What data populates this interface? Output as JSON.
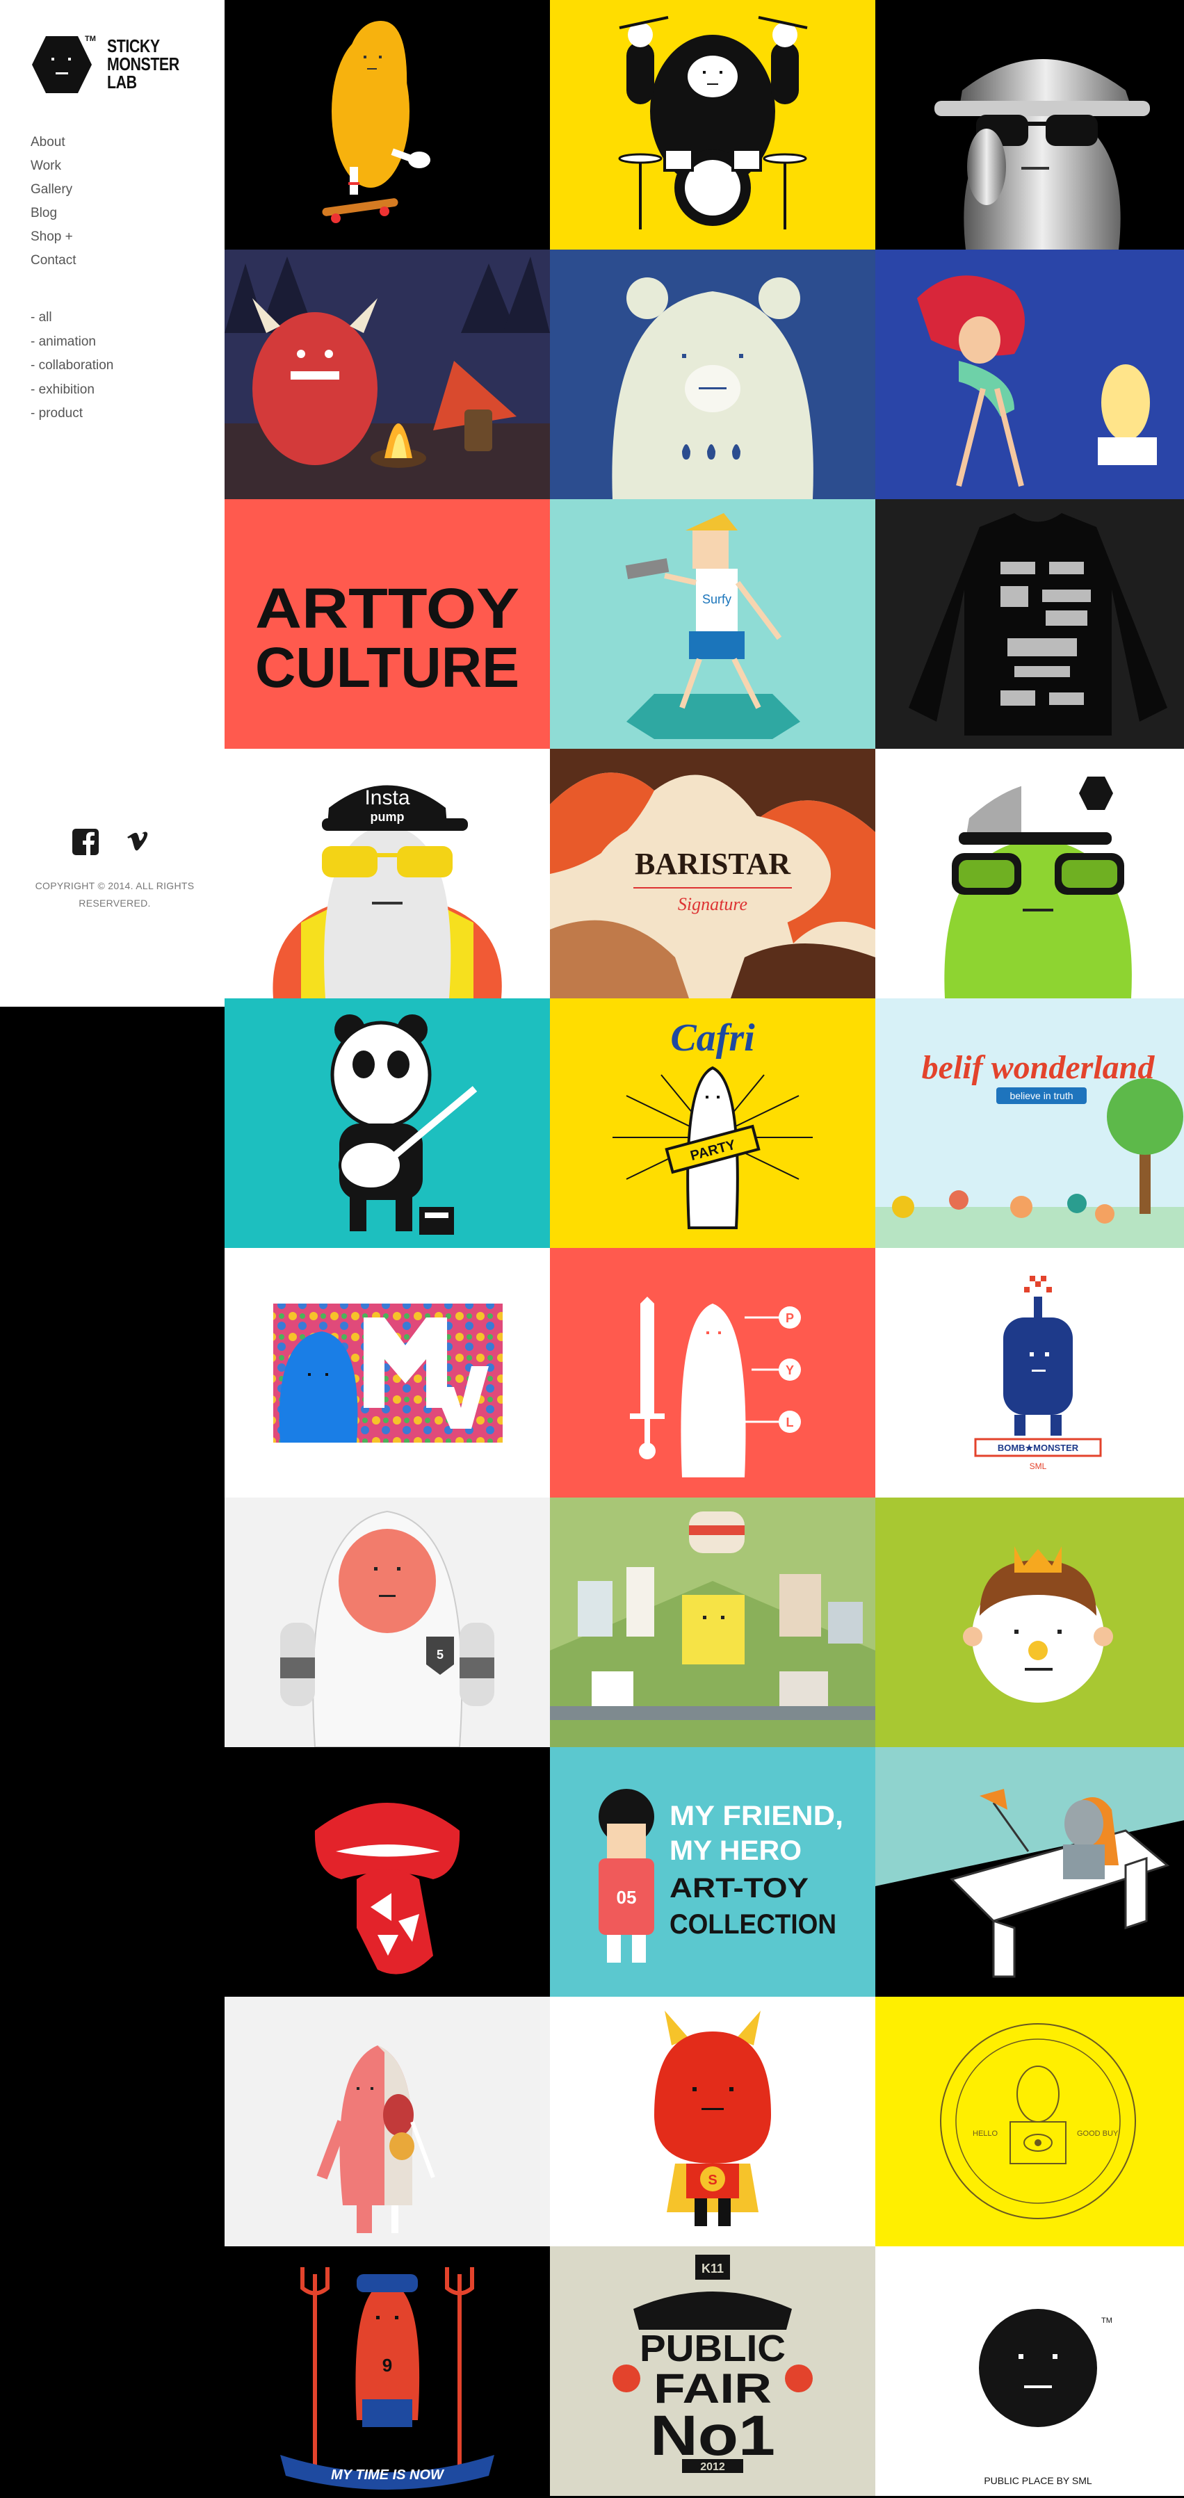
{
  "brand": {
    "line1": "STICKY",
    "line2": "MONSTER",
    "line3": "LAB",
    "tm": "TM"
  },
  "nav": [
    {
      "label": "About"
    },
    {
      "label": "Work"
    },
    {
      "label": "Gallery"
    },
    {
      "label": "Blog"
    },
    {
      "label": "Shop +"
    },
    {
      "label": "Contact"
    }
  ],
  "filters": [
    {
      "label": "- all"
    },
    {
      "label": "- animation"
    },
    {
      "label": "- collaboration"
    },
    {
      "label": "- exhibition"
    },
    {
      "label": "- product"
    }
  ],
  "social": {
    "facebook": "facebook-icon",
    "vimeo": "vimeo-icon"
  },
  "copyright": "COPYRIGHT © 2014. ALL RIGHTS RESERVERED.",
  "tiles": {
    "arttoy_line1": "ARTTOY",
    "arttoy_line2": "CULTURE",
    "surfy": "Surfy",
    "instapump_top": "Insta",
    "instapump_bottom": "pump",
    "baristar": "BARISTAR",
    "baristar_sub": "Signature",
    "cafri": "Cafri",
    "cafri_party": "PARTY",
    "belif": "belif wonderland",
    "belif_sub": "believe in truth",
    "pyl": [
      "P",
      "Y",
      "L"
    ],
    "bomb": "BOMB★MONSTER",
    "bomb_sub": "SML",
    "suit_badge": "5",
    "myfriend": [
      "MY FRIEND,",
      "MY HERO",
      "ART-TOY",
      "COLLECTION"
    ],
    "myfriend_num": "05",
    "hero_letter": "S",
    "mytime": "MY TIME IS NOW",
    "jersey": "9",
    "fair_top": "K11",
    "fair": [
      "PUBLIC",
      "FAIR",
      "No1"
    ],
    "fair_year": "2012",
    "public_place": "PUBLIC PLACE BY SML",
    "logo_tm": "TM",
    "pgh": [
      "HELLO",
      "GOOD BUY"
    ]
  },
  "colors": {
    "black": "#000000",
    "yellow": "#FFDD00",
    "coral": "#FF5A4E",
    "teal": "#1DBFBF",
    "aqua": "#5BC8CF",
    "lime": "#A8C832",
    "lightyellow": "#FFEF00",
    "mint": "#8FDCD5"
  }
}
